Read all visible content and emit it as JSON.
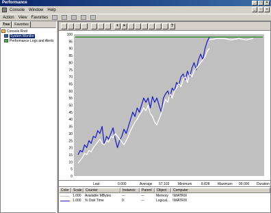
{
  "window": {
    "title": "Performance"
  },
  "menu": {
    "items": [
      "Console",
      "Window",
      "Help"
    ]
  },
  "toolbar": {
    "items": [
      "Action",
      "View",
      "Favorites"
    ]
  },
  "tabs": [
    "Tree",
    "Favorites"
  ],
  "tree": {
    "items": [
      {
        "label": "Console Root",
        "icon": "folder-icon"
      },
      {
        "label": "System Monitor",
        "icon": "monitor-icon"
      },
      {
        "label": "Performance Logs and Alerts",
        "icon": "perflog-icon"
      }
    ]
  },
  "chart_data": {
    "type": "line",
    "ylim": [
      0,
      100
    ],
    "y_ticks": [
      "100",
      "95",
      "90",
      "85",
      "80",
      "75",
      "70",
      "65",
      "60",
      "55",
      "50",
      "45",
      "40",
      "35",
      "30",
      "25",
      "20",
      "15",
      "10",
      "5",
      "0"
    ],
    "grid": "off",
    "series": [
      {
        "color": "#2020c0",
        "values": [
          15,
          18,
          17,
          22,
          20,
          25,
          23,
          28,
          27,
          32,
          30,
          35,
          22,
          28,
          26,
          30,
          34,
          26,
          20,
          25,
          28,
          33,
          30,
          35,
          40,
          45,
          42,
          48,
          45,
          50,
          55,
          52,
          55,
          48,
          56,
          52,
          55,
          50,
          45,
          55,
          58,
          60,
          56,
          62,
          60,
          66,
          64,
          70,
          72,
          68,
          74,
          70,
          76,
          80,
          75,
          82,
          86,
          82,
          90,
          95,
          98
        ]
      },
      {
        "color": "#ffffff",
        "values": [
          9,
          11,
          13,
          16,
          15,
          18,
          17,
          20,
          22,
          24,
          26,
          23,
          22,
          25,
          24,
          28,
          27,
          30,
          28,
          26,
          24,
          22,
          25,
          28,
          32,
          35,
          38,
          40,
          43,
          45,
          48,
          46,
          50,
          44,
          42,
          38,
          36,
          40,
          44,
          50,
          54,
          52,
          58,
          55,
          60,
          62,
          65,
          63,
          68,
          70,
          66,
          72,
          70,
          74,
          76,
          78,
          80,
          82,
          84,
          88,
          90
        ]
      },
      {
        "color": "#ffffff",
        "values": [
          96,
          97,
          97,
          96,
          97,
          96,
          97
        ]
      },
      {
        "color": "#208020",
        "values": [
          98,
          98
        ]
      }
    ]
  },
  "stats": {
    "last_label": "Last",
    "last_value": "0.000",
    "average_label": "Average",
    "average_value": "57.103",
    "minimum_label": "Minimum",
    "minimum_value": "8.828",
    "maximum_label": "Maximum",
    "maximum_value": "99.000",
    "duration_label": "Duration"
  },
  "legend": {
    "headers": [
      "Color",
      "Scale",
      "Counter",
      "Instance",
      "Parent",
      "Object",
      "Computer"
    ],
    "rows": [
      {
        "scale": "1.000",
        "counter": "Available MBytes",
        "instance": "---",
        "parent": "---",
        "object": "Memory",
        "computer": "\\\\MATRIX",
        "color": "#ffffff"
      },
      {
        "scale": "1.000",
        "counter": "% Disk Time",
        "instance": "0:",
        "parent": "---",
        "object": "Logical...",
        "computer": "\\\\MATRIX",
        "color": "#2020c0"
      }
    ]
  }
}
